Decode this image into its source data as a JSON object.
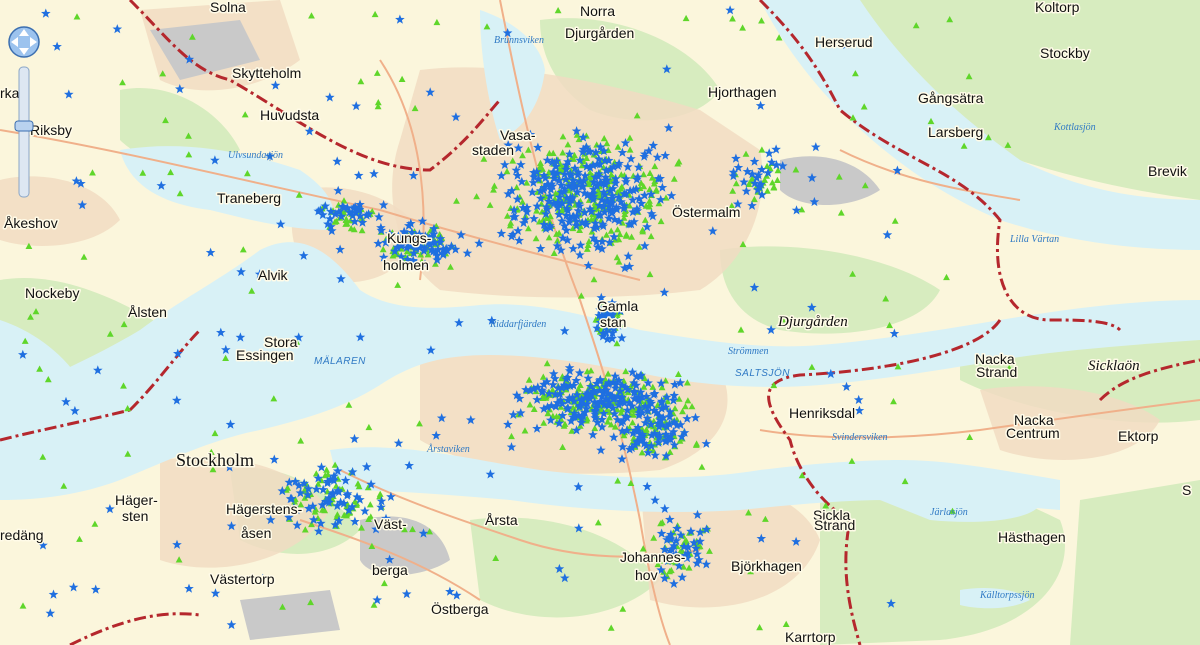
{
  "map": {
    "colors": {
      "water": "#d8f1f6",
      "land": "#fbf6dc",
      "park": "#d7ecbf",
      "urban": "#f1dcc2",
      "industrial": "#c9c9c9",
      "border": "#b5272d",
      "star_marker": "#1f6fe0",
      "triangle_marker": "#5fd62a"
    },
    "place_labels": [
      {
        "text": "Solna"
      },
      {
        "text": "Norra"
      },
      {
        "text": "Djurgården"
      },
      {
        "text": "Herserud"
      },
      {
        "text": "Koltorp"
      },
      {
        "text": "Stockby"
      },
      {
        "text": "Skytteholm"
      },
      {
        "text": "Hjorthagen"
      },
      {
        "text": "Gångsätra"
      },
      {
        "text": "Riksby"
      },
      {
        "text": "Huvudsta"
      },
      {
        "text": "Larsberg"
      },
      {
        "text": "Vasa-"
      },
      {
        "text": "staden"
      },
      {
        "text": "Traneberg"
      },
      {
        "text": "Brevik"
      },
      {
        "text": "Åkeshov"
      },
      {
        "text": "Östermalm"
      },
      {
        "text": "Kungs-"
      },
      {
        "text": "holmen"
      },
      {
        "text": "Alvik"
      },
      {
        "text": "Nockeby"
      },
      {
        "text": "Ålsten"
      },
      {
        "text": "Gamla"
      },
      {
        "text": "stan"
      },
      {
        "text": "Stora"
      },
      {
        "text": "Essingen"
      },
      {
        "text": "Nacka"
      },
      {
        "text": "Strand"
      },
      {
        "text": "Henriksdal"
      },
      {
        "text": "Nacka"
      },
      {
        "text": "Centrum"
      },
      {
        "text": "Ektorp"
      },
      {
        "text": "Hägerstens-"
      },
      {
        "text": "åsen"
      },
      {
        "text": "Häger-"
      },
      {
        "text": "sten"
      },
      {
        "text": "Sickla"
      },
      {
        "text": "Strand"
      },
      {
        "text": "Årsta"
      },
      {
        "text": "Väst-"
      },
      {
        "text": "berga"
      },
      {
        "text": "Johannes-"
      },
      {
        "text": "hov"
      },
      {
        "text": "Björkhagen"
      },
      {
        "text": "Hästhagen"
      },
      {
        "text": "Västertorp"
      },
      {
        "text": "Östberga"
      },
      {
        "text": "Karrtorp"
      },
      {
        "text": "redäng"
      },
      {
        "text": "rka"
      },
      {
        "text": "S"
      }
    ],
    "large_labels": [
      {
        "text": "Stockholm"
      }
    ],
    "area_labels": [
      {
        "text": "Djurgården"
      },
      {
        "text": "Sicklaön"
      }
    ],
    "water_labels": [
      {
        "text": "Brunnsviken"
      },
      {
        "text": "Ulvsundasjön"
      },
      {
        "text": "Kottlasjön"
      },
      {
        "text": "Lilla Värtan"
      },
      {
        "text": "Riddarfjärden"
      },
      {
        "text": "Strömmen"
      },
      {
        "text": "Svindersviken"
      },
      {
        "text": "Årstaviken"
      },
      {
        "text": "Järlasjön"
      },
      {
        "text": "Källtorpssjön"
      }
    ],
    "water_caps_labels": [
      {
        "text": "MÄLAREN"
      },
      {
        "text": "SALTSJÖN"
      }
    ],
    "marker_legend": {
      "star": "blue-star-marker",
      "triangle": "green-triangle-marker"
    }
  },
  "controls": {
    "pan_icon": "pan-arrows-icon",
    "zoom_level_fraction": 0.55
  }
}
